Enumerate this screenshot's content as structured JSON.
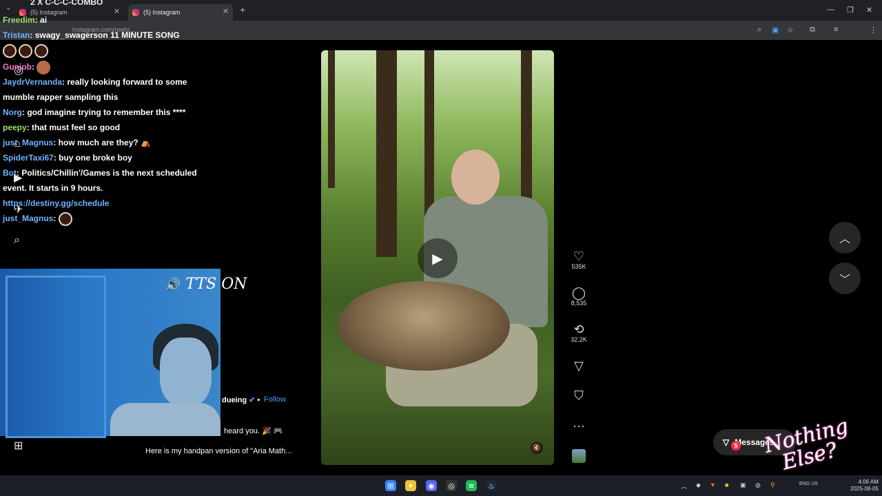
{
  "browser": {
    "tabs": [
      {
        "title": "(5) Instagram",
        "active": false
      },
      {
        "title": "(5) Instagram",
        "active": true
      }
    ],
    "url": "instagram.com/reels/..."
  },
  "overlay": {
    "combo_text": "2 X C-C-C-COMBO",
    "chat": [
      {
        "user": "Freedim",
        "user_color": "#9be36b",
        "text": ": ai"
      },
      {
        "user": "Tristan",
        "user_color": "#6fb3ff",
        "text": ": swagy_swagerson 11 MINUTE SONG"
      },
      {
        "user": "",
        "user_color": "#ffffff",
        "text": ""
      },
      {
        "user": "Gunjob",
        "user_color": "#ff7ad9",
        "text": ":"
      },
      {
        "user": "JaydrVernanda",
        "user_color": "#6fb3ff",
        "text": ": really looking forward to some mumble rapper sampling this"
      },
      {
        "user": "Norg",
        "user_color": "#6fb3ff",
        "text": ": god imagine trying to remember this ****"
      },
      {
        "user": "peepy",
        "user_color": "#9be36b",
        "text": ": that must feel so good"
      },
      {
        "user": "just_Magnus",
        "user_color": "#6fb3ff",
        "text": ": how much are they?"
      },
      {
        "user": "SpiderTaxi67",
        "user_color": "#6fb3ff",
        "text": ": buy one broke boy"
      },
      {
        "user": "Bot",
        "user_color": "#6fb3ff",
        "text": ": Politics/Chillin'/Games is the next scheduled event. It starts in 9 hours."
      },
      {
        "user": "",
        "user_color": "#6fb3ff",
        "text": "https://destiny.gg/schedule"
      },
      {
        "user": "just_Magnus",
        "user_color": "#6fb3ff",
        "text": ":"
      }
    ],
    "tts_label": "TTS ON"
  },
  "reel": {
    "owner": "dueing",
    "follow_label": "Follow",
    "comment_snippet": "heard you. 🎉 🎮",
    "caption": "Here is my handpan version of \"Aria Math...",
    "likes": "535K",
    "comments": "8,535",
    "reposts": "32.2K"
  },
  "messages": {
    "label": "Messages",
    "badge": "5"
  },
  "logo_text": "Nothing Else?",
  "taskbar": {
    "lang": "ENG US",
    "time": "4:06 AM",
    "date": "2025-08-05"
  },
  "colors": {
    "link": "#4a9eff",
    "badge": "#ff3040"
  }
}
